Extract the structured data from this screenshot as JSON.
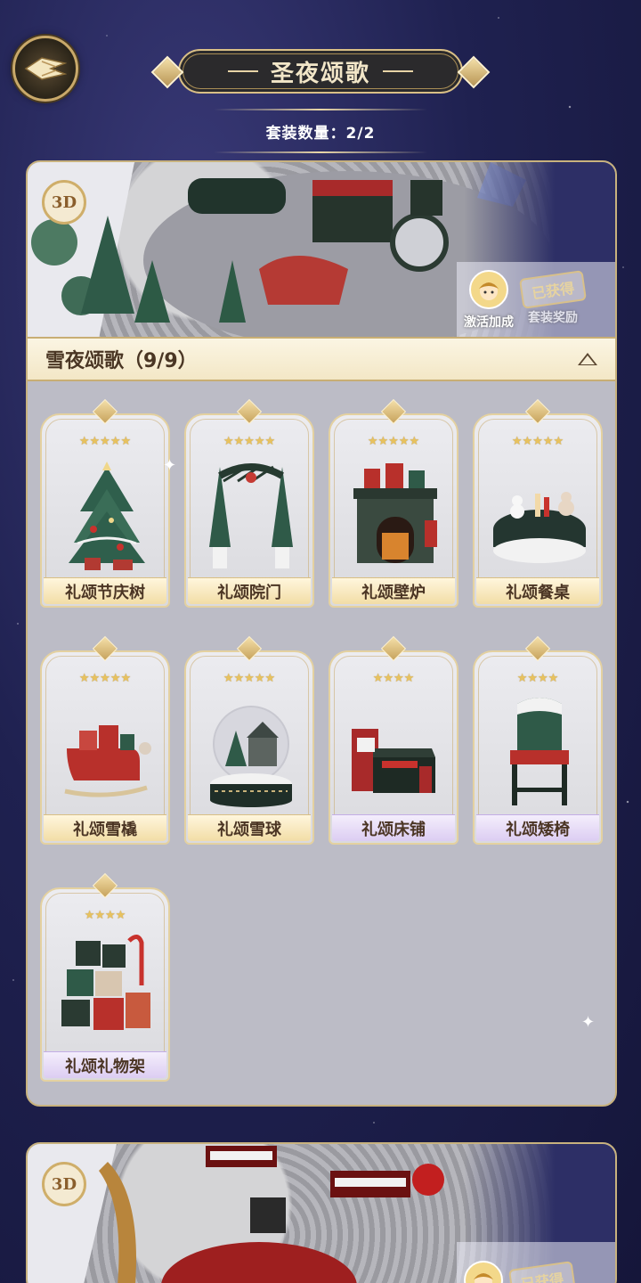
{
  "header": {
    "title": "圣夜颂歌",
    "suit_count": "套装数量：2/2"
  },
  "suits": [
    {
      "badge": "3D",
      "rewards": [
        {
          "label": "激活加成",
          "icon": "elf-head-icon"
        },
        {
          "label": "套装奖励",
          "stamp": "已获得"
        }
      ],
      "set_title": "雪夜颂歌（9/9）",
      "items": [
        {
          "label": "礼颂节庆树",
          "stars": "★★★★★",
          "label_style": "gold",
          "icon": "christmas-tree"
        },
        {
          "label": "礼颂院门",
          "stars": "★★★★★",
          "label_style": "gold",
          "icon": "garden-gate"
        },
        {
          "label": "礼颂壁炉",
          "stars": "★★★★★",
          "label_style": "gold",
          "icon": "fireplace"
        },
        {
          "label": "礼颂餐桌",
          "stars": "★★★★★",
          "label_style": "gold",
          "icon": "dining-table"
        },
        {
          "label": "礼颂雪橇",
          "stars": "★★★★★",
          "label_style": "gold",
          "icon": "sleigh"
        },
        {
          "label": "礼颂雪球",
          "stars": "★★★★★",
          "label_style": "gold",
          "icon": "snow-globe"
        },
        {
          "label": "礼颂床铺",
          "stars": "★★★★",
          "label_style": "purple",
          "icon": "bed"
        },
        {
          "label": "礼颂矮椅",
          "stars": "★★★★",
          "label_style": "purple",
          "icon": "chair"
        },
        {
          "label": "礼颂礼物架",
          "stars": "★★★★",
          "label_style": "purple",
          "icon": "gift-shelf"
        }
      ]
    },
    {
      "badge": "3D",
      "rewards": [
        {
          "label": "",
          "stamp": "已获得"
        }
      ]
    }
  ],
  "colors": {
    "accent_gold": "#d9bf86",
    "plaque_dark": "#2b2a2c",
    "label_gold": "#f2dda6",
    "label_purple": "#dccdf2"
  }
}
